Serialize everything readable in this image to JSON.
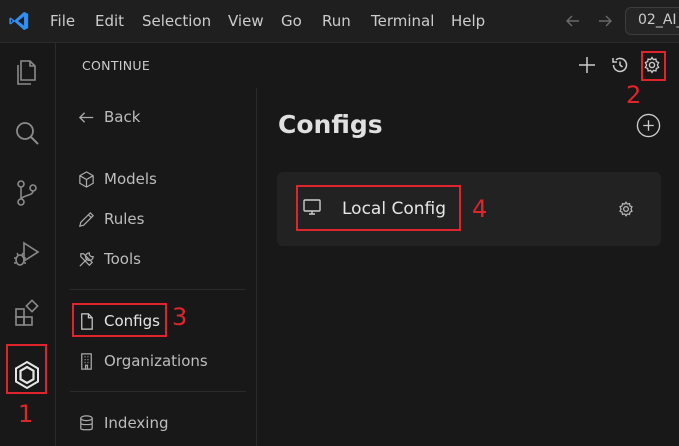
{
  "menubar": {
    "items": [
      "File",
      "Edit",
      "Selection",
      "View",
      "Go",
      "Run",
      "Terminal",
      "Help"
    ],
    "window_title": "02_AI_"
  },
  "sidebar": {
    "title": "CONTINUE",
    "back_label": "Back",
    "nav": {
      "models": "Models",
      "rules": "Rules",
      "tools": "Tools",
      "configs": "Configs",
      "organizations": "Organizations",
      "indexing": "Indexing"
    }
  },
  "main": {
    "title": "Configs",
    "config_card_label": "Local Config"
  },
  "annotations": {
    "one": "1",
    "two": "2",
    "three": "3",
    "four": "4"
  },
  "colors": {
    "accent_blue": "#2f8ff5",
    "annotation_red": "#e0242b",
    "background": "#181818"
  }
}
